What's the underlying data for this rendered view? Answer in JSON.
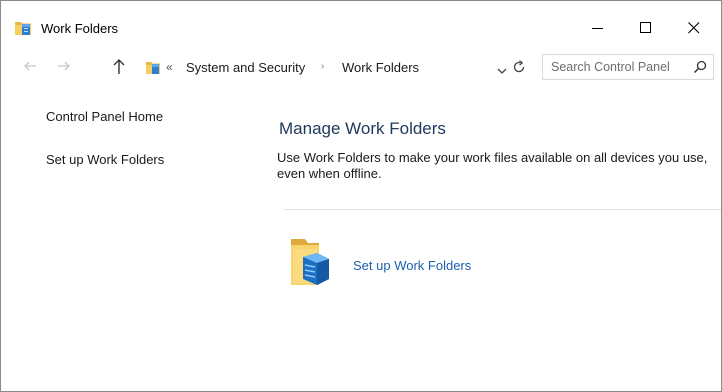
{
  "window": {
    "title": "Work Folders",
    "accent_color": "#1c5fb0"
  },
  "caption_buttons": {
    "minimize_icon": "minimize-icon",
    "maximize_icon": "maximize-icon",
    "close_icon": "close-icon"
  },
  "address": {
    "overflow_glyph": "«",
    "crumbs": [
      "System and Security",
      "Work Folders"
    ],
    "separator_glyph": "›"
  },
  "search": {
    "placeholder": "Search Control Panel"
  },
  "left_pane": {
    "items": [
      {
        "label": "Control Panel Home"
      },
      {
        "label": "Set up Work Folders"
      }
    ]
  },
  "main": {
    "title": "Manage Work Folders",
    "description": "Use Work Folders to make your work files available on all devices you use, even when offline.",
    "task": {
      "label": "Set up Work Folders",
      "icon": "work-folders-icon"
    }
  }
}
